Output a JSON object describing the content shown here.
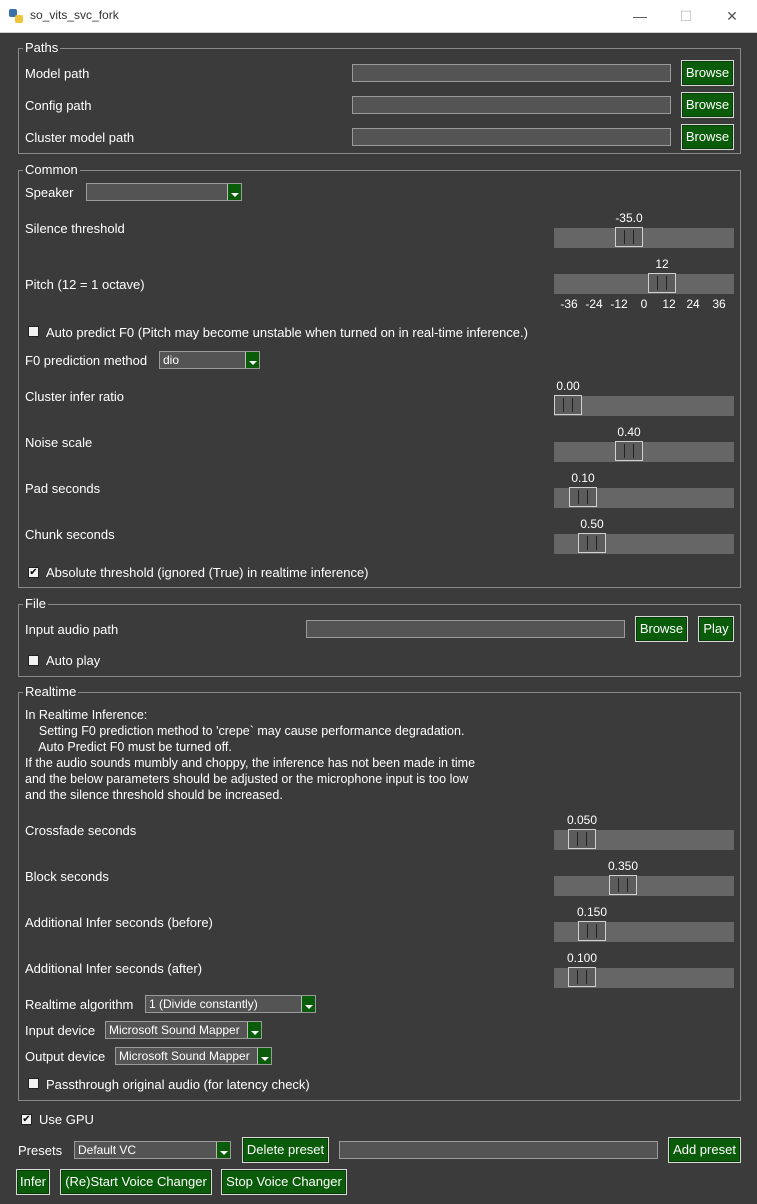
{
  "window": {
    "title": "so_vits_svc_fork",
    "minimize": "—",
    "maximize": "☐",
    "close": "✕"
  },
  "paths": {
    "legend": "Paths",
    "model_path_label": "Model path",
    "config_path_label": "Config path",
    "cluster_model_path_label": "Cluster model path",
    "model_path_value": "",
    "config_path_value": "",
    "cluster_model_path_value": "",
    "browse_label": "Browse"
  },
  "common": {
    "legend": "Common",
    "speaker_label": "Speaker",
    "speaker_value": "",
    "silence_threshold_label": "Silence threshold",
    "silence_threshold_value": "-35.0",
    "silence_threshold_fraction": 0.4,
    "pitch_label": "Pitch (12 = 1 octave)",
    "pitch_value": "12",
    "pitch_fraction": 0.62,
    "pitch_ticks": [
      "-36",
      "-24",
      "-12",
      "0",
      "12",
      "24",
      "36"
    ],
    "auto_predict_f0_label": "Auto predict F0 (Pitch may become unstable when turned on in real-time inference.)",
    "auto_predict_f0_checked": false,
    "f0_method_label": "F0 prediction method",
    "f0_method_value": "dio",
    "cluster_infer_ratio_label": "Cluster infer ratio",
    "cluster_infer_ratio_value": "0.00",
    "cluster_infer_ratio_fraction": 0.0,
    "noise_scale_label": "Noise scale",
    "noise_scale_value": "0.40",
    "noise_scale_fraction": 0.4,
    "pad_seconds_label": "Pad seconds",
    "pad_seconds_value": "0.10",
    "pad_seconds_fraction": 0.1,
    "chunk_seconds_label": "Chunk seconds",
    "chunk_seconds_value": "0.50",
    "chunk_seconds_fraction": 0.16,
    "absolute_threshold_label": "Absolute threshold (ignored (True) in realtime inference)",
    "absolute_threshold_checked": true
  },
  "file": {
    "legend": "File",
    "input_audio_path_label": "Input audio path",
    "input_audio_path_value": "",
    "browse_label": "Browse",
    "play_label": "Play",
    "auto_play_label": "Auto play",
    "auto_play_checked": false
  },
  "realtime": {
    "legend": "Realtime",
    "info_text": "In Realtime Inference:\n    Setting F0 prediction method to 'crepe` may cause performance degradation.\n    Auto Predict F0 must be turned off.\nIf the audio sounds mumbly and choppy, the inference has not been made in time\nand the below parameters should be adjusted or the microphone input is too low\nand the silence threshold should be increased.",
    "crossfade_label": "Crossfade seconds",
    "crossfade_value": "0.050",
    "crossfade_fraction": 0.09,
    "block_label": "Block seconds",
    "block_value": "0.350",
    "block_fraction": 0.36,
    "additional_before_label": "Additional Infer seconds (before)",
    "additional_before_value": "0.150",
    "additional_before_fraction": 0.16,
    "additional_after_label": "Additional Infer seconds (after)",
    "additional_after_value": "0.100",
    "additional_after_fraction": 0.09,
    "algorithm_label": "Realtime algorithm",
    "algorithm_value": "1 (Divide constantly)",
    "input_device_label": "Input device",
    "input_device_value": "Microsoft Sound Mapper",
    "output_device_label": "Output device",
    "output_device_value": "Microsoft Sound Mapper",
    "passthrough_label": "Passthrough original audio (for latency check)",
    "passthrough_checked": false
  },
  "bottom": {
    "use_gpu_label": "Use GPU",
    "use_gpu_checked": true,
    "presets_label": "Presets",
    "preset_value": "Default VC",
    "delete_preset_label": "Delete preset",
    "new_preset_name_value": "",
    "add_preset_label": "Add preset",
    "infer_label": "Infer",
    "restart_label": "(Re)Start Voice Changer",
    "stop_label": "Stop Voice Changer"
  }
}
